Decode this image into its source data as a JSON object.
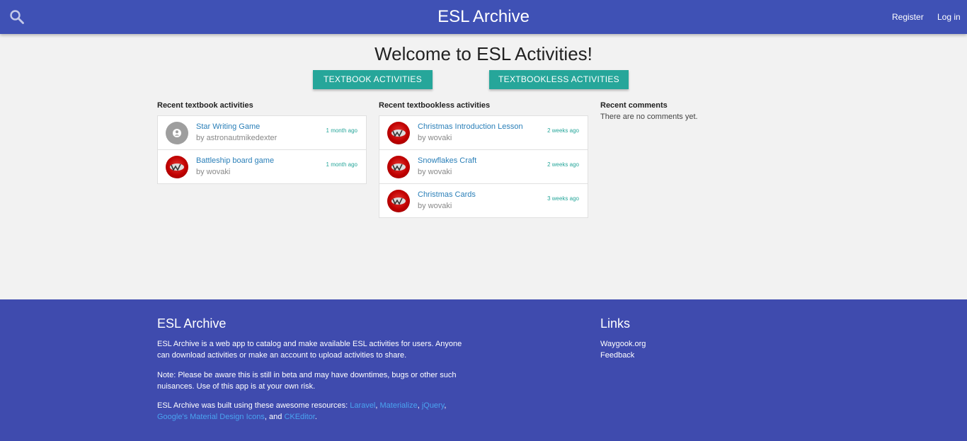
{
  "header": {
    "title": "ESL Archive",
    "register_label": "Register",
    "login_label": "Log in",
    "search_icon": "search-icon",
    "bg_color": "#3f51b5"
  },
  "main": {
    "welcome": "Welcome to ESL Activities!",
    "buttons": {
      "textbook": "TEXTBOOK ACTIVITIES",
      "textbookless": "TEXTBOOKLESS ACTIVITIES"
    },
    "recent_textbook": {
      "title": "Recent textbook activities",
      "items": [
        {
          "title": "Star Writing Game",
          "author": "by astronautmikedexter",
          "time": "1 month ago",
          "avatar": "default-user-icon"
        },
        {
          "title": "Battleship board game",
          "author": "by wovaki",
          "time": "1 month ago",
          "avatar": "wovaki-avatar"
        }
      ]
    },
    "recent_textbookless": {
      "title": "Recent textbookless activities",
      "items": [
        {
          "title": "Christmas Introduction Lesson",
          "author": "by wovaki",
          "time": "2 weeks ago",
          "avatar": "wovaki-avatar"
        },
        {
          "title": "Snowflakes Craft",
          "author": "by wovaki",
          "time": "2 weeks ago",
          "avatar": "wovaki-avatar"
        },
        {
          "title": "Christmas Cards",
          "author": "by wovaki",
          "time": "3 weeks ago",
          "avatar": "wovaki-avatar"
        }
      ]
    },
    "recent_comments": {
      "title": "Recent comments",
      "empty_text": "There are no comments yet."
    },
    "accent_color": "#26a69a",
    "link_color": "#2a7fb8"
  },
  "footer": {
    "title": "ESL Archive",
    "para1": "ESL Archive is a web app to catalog and make available ESL activities for users. Anyone can download activities or make an account to upload activities to share.",
    "para2": "Note: Please be aware this is still in beta and may have downtimes, bugs or other such nuisances. Use of this app is at your own risk.",
    "para3_prefix": "ESL Archive was built using these awesome resources: ",
    "resources": [
      "Laravel",
      "Materialize",
      "jQuery",
      "Google's Material Design Icons",
      "CKEditor"
    ],
    "sep_comma": ", ",
    "sep_and": ", and ",
    "para3_suffix": ".",
    "links_title": "Links",
    "links": [
      "Waygook.org",
      "Feedback"
    ],
    "bg_color": "#3f4bae"
  }
}
